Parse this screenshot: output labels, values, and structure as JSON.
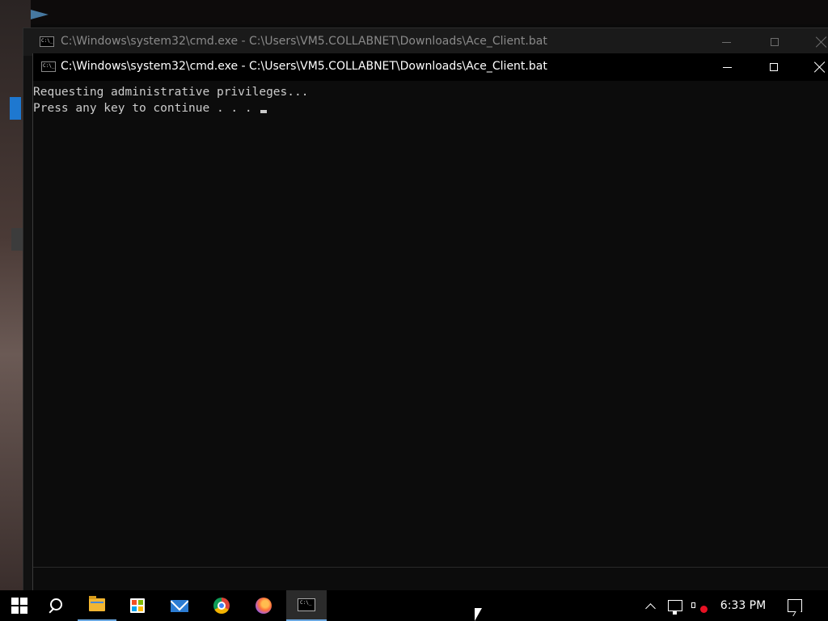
{
  "back_window": {
    "title": "C:\\Windows\\system32\\cmd.exe - C:\\Users\\VM5.COLLABNET\\Downloads\\Ace_Client.bat"
  },
  "front_window": {
    "title": "C:\\Windows\\system32\\cmd.exe - C:\\Users\\VM5.COLLABNET\\Downloads\\Ace_Client.bat",
    "console_lines": [
      "Requesting administrative privileges...",
      "Press any key to continue . . . "
    ]
  },
  "taskbar": {
    "items": [
      {
        "icon": "windows-start-icon",
        "running": false
      },
      {
        "icon": "search-icon",
        "running": false
      },
      {
        "icon": "file-explorer-icon",
        "running": true
      },
      {
        "icon": "microsoft-store-icon",
        "running": false
      },
      {
        "icon": "mail-icon",
        "running": false
      },
      {
        "icon": "chrome-icon",
        "running": false
      },
      {
        "icon": "firefox-icon",
        "running": false
      },
      {
        "icon": "command-prompt-icon",
        "running": true,
        "active": true
      }
    ],
    "tray": {
      "clock": "6:33 PM",
      "icons": [
        "show-hidden-icons-chevron-icon",
        "network-icon",
        "volume-muted-icon",
        "action-center-icon"
      ]
    }
  },
  "colors": {
    "console_bg": "#0c0c0c",
    "console_fg": "#cccccc",
    "taskbar_bg": "#000000",
    "running_indicator": "#6aa7e0"
  }
}
